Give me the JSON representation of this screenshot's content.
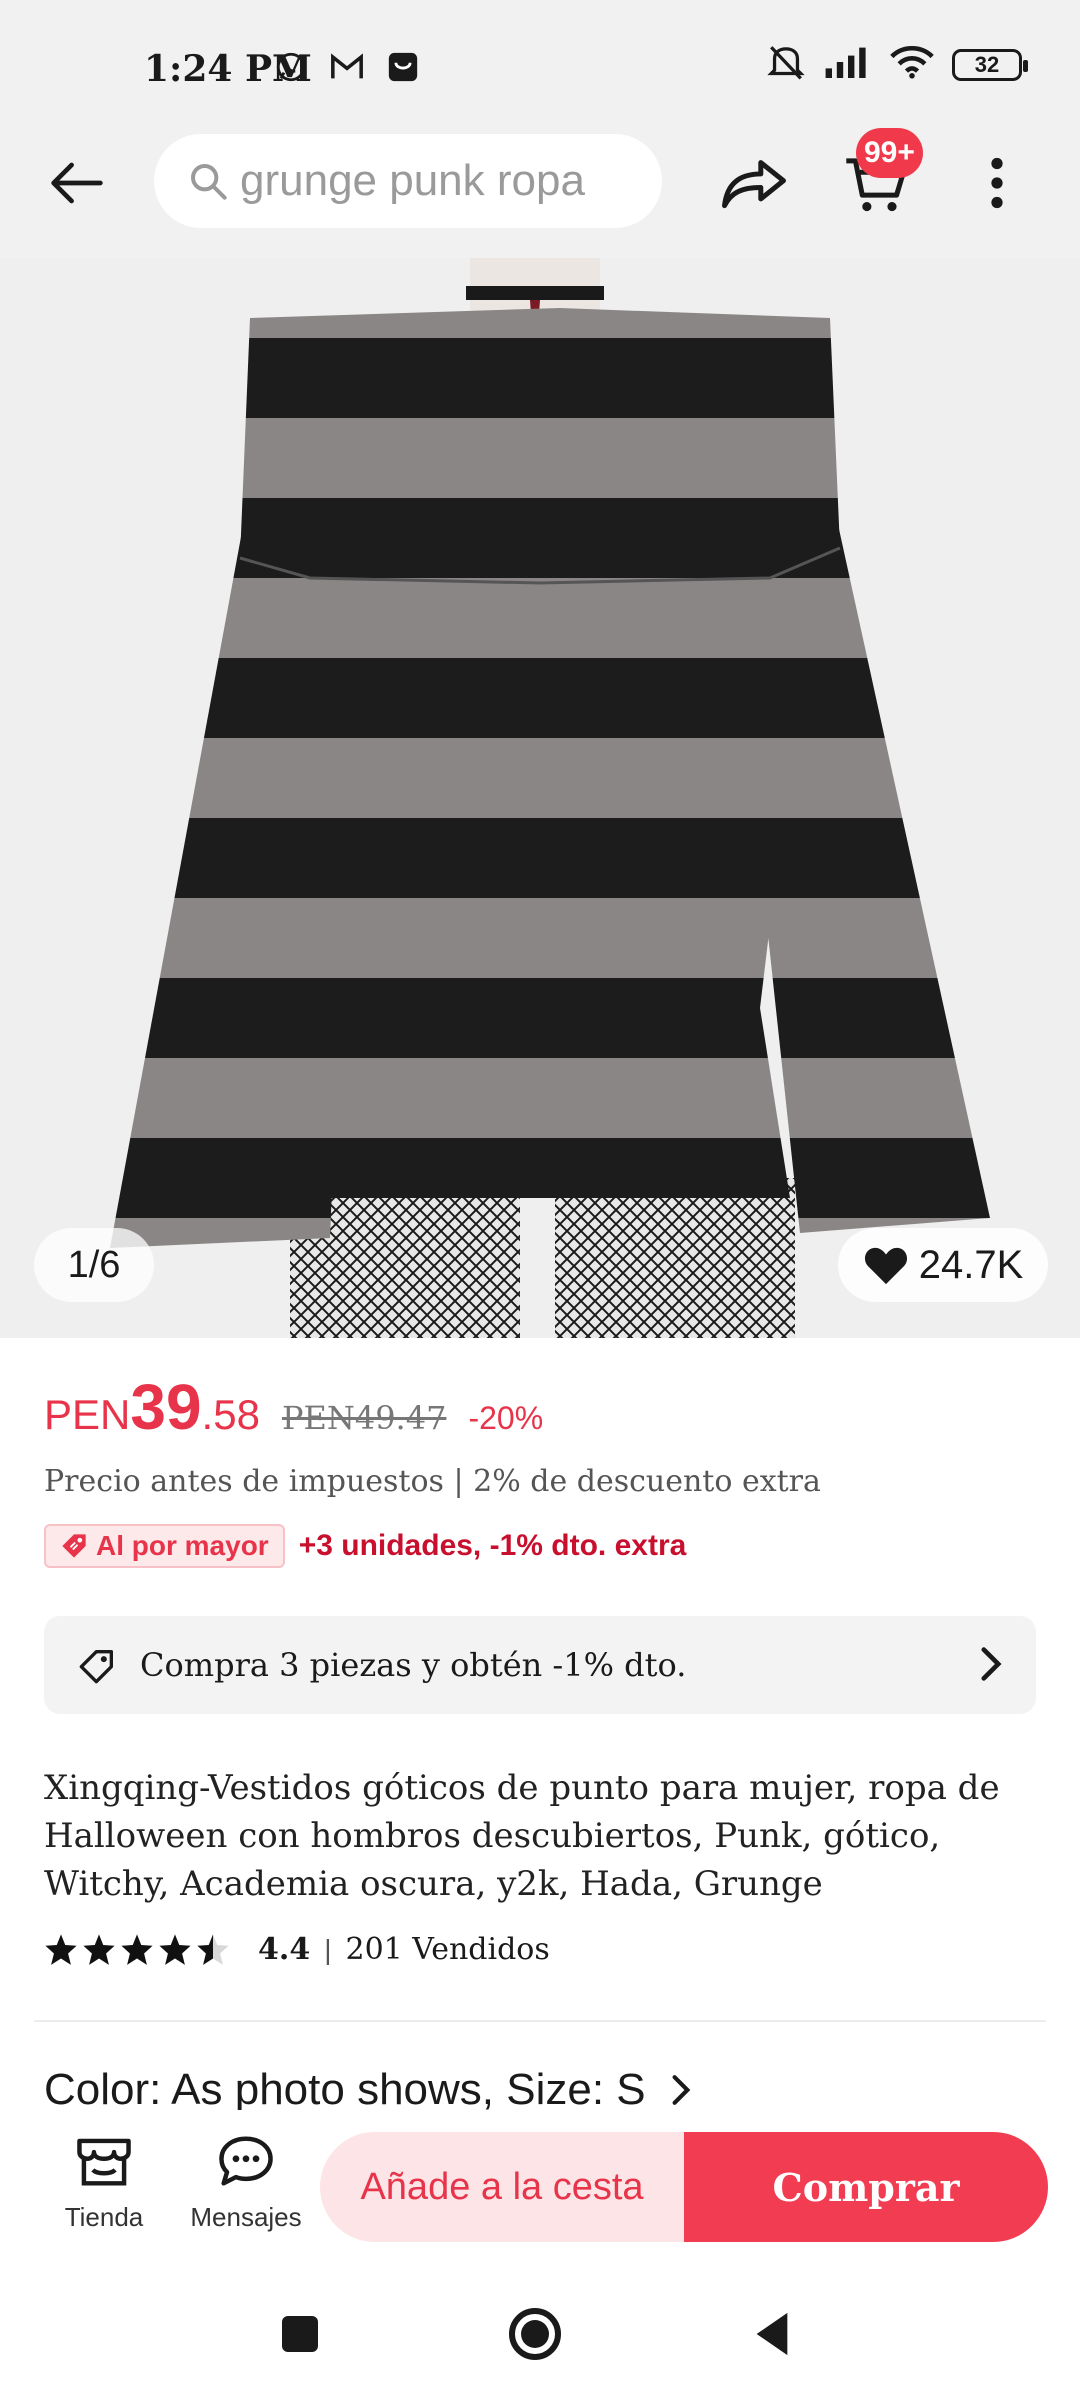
{
  "status_bar": {
    "time": "1:24 PM",
    "icons": [
      "whatsapp-icon",
      "gmail-icon",
      "shop-icon"
    ],
    "right_icons": [
      "mute-icon",
      "signal-icon",
      "wifi-icon"
    ],
    "battery": "32"
  },
  "header": {
    "search_query": "grunge punk ropa",
    "cart_badge": "99+"
  },
  "gallery": {
    "counter": "1/6",
    "wishlist_count": "24.7K"
  },
  "price": {
    "currency": "PEN",
    "integer": "39",
    "decimal": ".58",
    "original": "PEN49.47",
    "discount": "-20%",
    "tax_note": "Precio antes de impuestos | 2% de descuento extra"
  },
  "wholesale": {
    "badge": "Al por mayor",
    "offer": "+3 unidades, -1% dto. extra"
  },
  "promo": {
    "text": "Compra 3 piezas y obtén -1% dto."
  },
  "product": {
    "title": "Xingqing-Vestidos góticos de punto para mujer, ropa de Halloween con hombros descubiertos, Punk, gótico, Witchy, Academia oscura, y2k, Hada, Grunge",
    "rating": "4.4",
    "rating_value": 4.4,
    "separator": "|",
    "sold": "201 Vendidos"
  },
  "variant": {
    "text": "Color: As photo shows, Size: S"
  },
  "actions": {
    "store_label": "Tienda",
    "messages_label": "Mensajes",
    "add_to_cart": "Añade a la cesta",
    "buy_now": "Comprar"
  },
  "colors": {
    "accent": "#e8344a",
    "buy_button": "#f23c52",
    "cart_button_bg": "#fde4e7"
  }
}
